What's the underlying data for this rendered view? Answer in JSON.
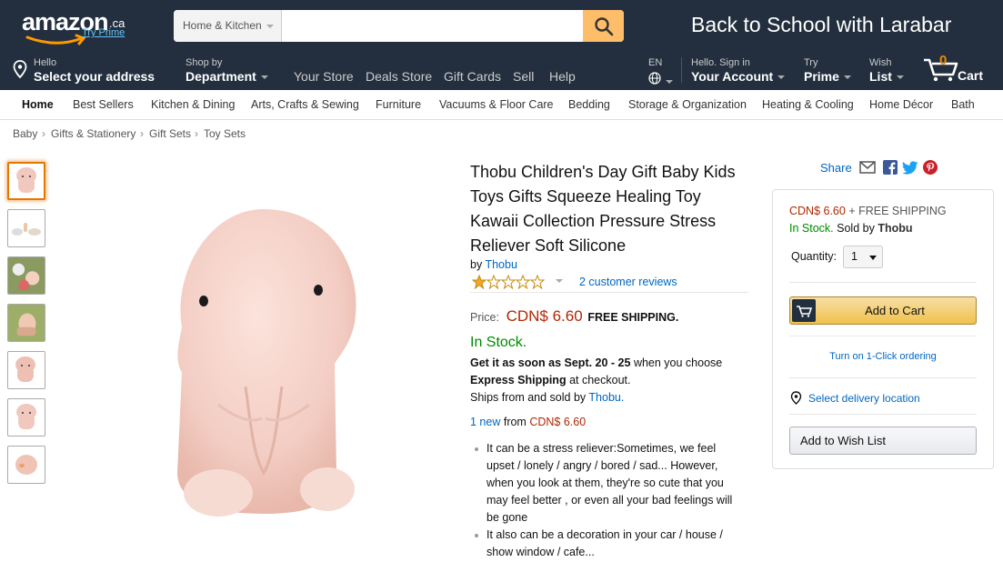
{
  "header": {
    "logo_text": "amazon",
    "logo_tld": ".ca",
    "logo_prime": "Try Prime",
    "search_category": "Home & Kitchen",
    "search_value": "",
    "promo": "Back to School with Larabar"
  },
  "nav": {
    "address_small": "Hello",
    "address_big": "Select your address",
    "dept_small": "Shop by",
    "dept_big": "Department",
    "links": [
      "Your Store",
      "Deals Store",
      "Gift Cards",
      "Sell",
      "Help"
    ],
    "lang": "EN",
    "account_small": "Hello. Sign in",
    "account_big": "Your Account",
    "prime_small": "Try",
    "prime_big": "Prime",
    "wish_small": "Wish",
    "wish_big": "List",
    "cart_count": "0",
    "cart_label": "Cart"
  },
  "subnav": [
    "Home",
    "Best Sellers",
    "Kitchen & Dining",
    "Arts, Crafts & Sewing",
    "Furniture",
    "Vacuums & Floor Care",
    "Bedding",
    "Storage & Organization",
    "Heating & Cooling",
    "Home Décor",
    "Bath"
  ],
  "breadcrumb": [
    "Baby",
    "Gifts & Stationery",
    "Gift Sets",
    "Toy Sets"
  ],
  "breadcrumb_sep": "›",
  "product": {
    "title": "Thobu Children's Day Gift Baby Kids Toys Gifts Squeeze Healing Toy Kawaii Collection Pressure Stress Reliever Soft Silicone",
    "by_label": "by",
    "brand": "Thobu",
    "rating": 1,
    "reviews": "2 customer reviews",
    "price_label": "Price:",
    "price": "CDN$ 6.60",
    "shipping": "FREE SHIPPING.",
    "stock": "In Stock.",
    "delivery_1": "Get it as soon as",
    "delivery_date": "Sept. 20 - 25",
    "delivery_2": "when you choose",
    "delivery_express": "Express Shipping",
    "delivery_3": "at checkout.",
    "ships_text": "Ships from and sold by",
    "ships_seller": "Thobu.",
    "new_count": "1 new",
    "new_from": "from",
    "new_price": "CDN$ 6.60",
    "bullets": [
      "It can be a stress reliever:Sometimes, we feel upset / lonely / angry / bored / sad... However, when you look at them, they're so cute that you may feel better , or even all your bad feelings will be gone",
      "It also can be a decoration in your car / house / show window / cafe..."
    ]
  },
  "share": {
    "label": "Share"
  },
  "buybox": {
    "price": "CDN$ 6.60",
    "shipping": "+ FREE SHIPPING",
    "stock": "In Stock.",
    "sold_by_label": "Sold by",
    "sold_by": "Thobu",
    "qty_label": "Quantity:",
    "qty_value": "1",
    "add_to_cart": "Add to Cart",
    "one_click": "Turn on 1-Click ordering",
    "delivery": "Select delivery location",
    "wishlist": "Add to Wish List"
  },
  "colors": {
    "header_bg": "#232f3e",
    "search_btn": "#febd69",
    "price": "#b12704",
    "stock": "#008a00",
    "link": "#0066c0",
    "cart_orange": "#f08804"
  }
}
